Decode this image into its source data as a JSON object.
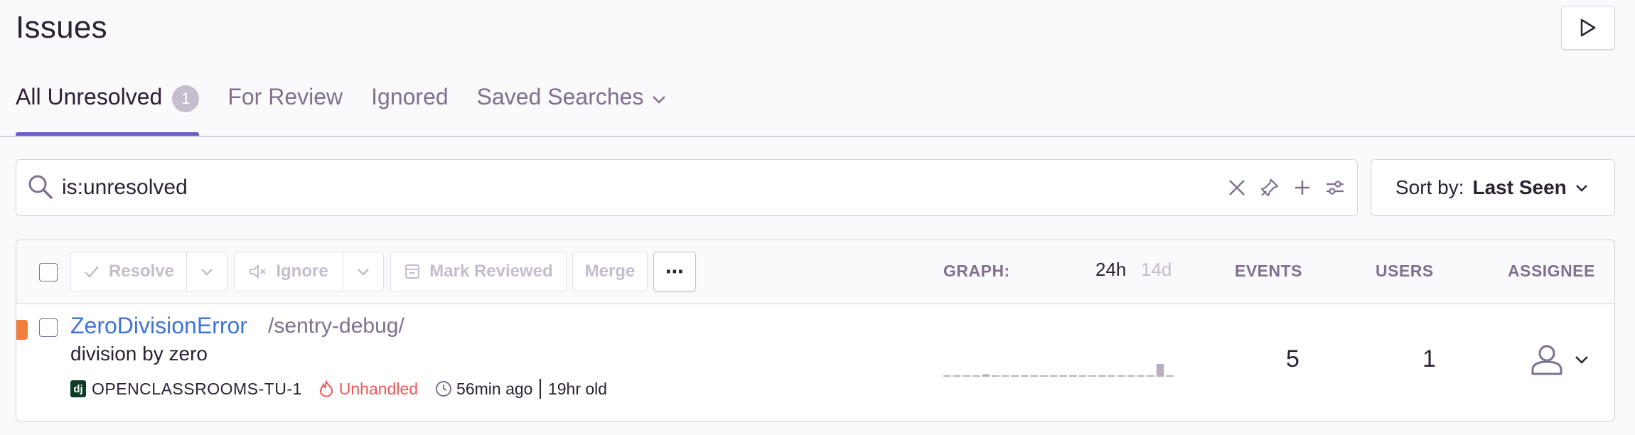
{
  "header": {
    "title": "Issues",
    "play_button_icon": "play-icon"
  },
  "tabs": [
    {
      "label": "All Unresolved",
      "count": "1",
      "active": true
    },
    {
      "label": "For Review",
      "active": false
    },
    {
      "label": "Ignored",
      "active": false
    },
    {
      "label": "Saved Searches",
      "active": false,
      "icon": "chevron-down-icon"
    }
  ],
  "search": {
    "query": "is:unresolved",
    "icons": [
      "search-icon",
      "clear-icon",
      "pin-icon",
      "add-icon",
      "filter-settings-icon"
    ]
  },
  "sort": {
    "label": "Sort by:",
    "value": "Last Seen"
  },
  "actions": {
    "resolve": "Resolve",
    "ignore": "Ignore",
    "mark_reviewed": "Mark Reviewed",
    "merge": "Merge",
    "more": "⋯"
  },
  "columns": {
    "graph": "GRAPH:",
    "period_active": "24h",
    "period_other": "14d",
    "events": "EVENTS",
    "users": "USERS",
    "assignee": "ASSIGNEE"
  },
  "issues": [
    {
      "level_color": "#f07e3c",
      "title": "ZeroDivisionError",
      "culprit": "/sentry-debug/",
      "message": "division by zero",
      "platform_icon": "django-icon",
      "platform_label": "dj",
      "short_id": "OPENCLASSROOMS-TU-1",
      "mechanism": "Unhandled",
      "last_seen": "56min ago",
      "first_seen": "19hr old",
      "events": "5",
      "users": "1",
      "sparkline": [
        0,
        0,
        0,
        0,
        0.2,
        0,
        0,
        0,
        0,
        0,
        0,
        0,
        0,
        0,
        0,
        0,
        0,
        0,
        0,
        0,
        0,
        0,
        1,
        0
      ]
    }
  ],
  "colors": {
    "accent": "#6c5fc7",
    "link": "#3d74db",
    "unhandled": "#f55459",
    "muted": "#80708f"
  }
}
